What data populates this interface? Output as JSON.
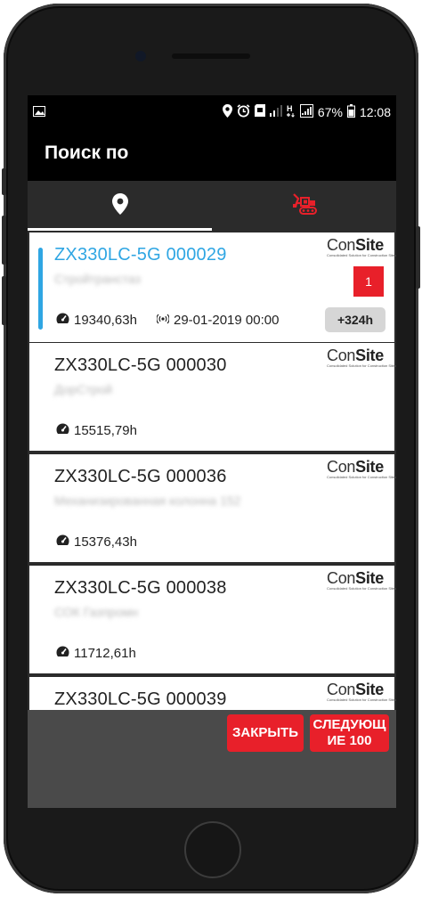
{
  "status_bar": {
    "battery_percent": "67%",
    "time": "12:08"
  },
  "app_bar": {
    "title": "Поиск по"
  },
  "tabs": [
    {
      "icon": "location-pin-icon",
      "active": true
    },
    {
      "icon": "excavator-icon",
      "active": false
    }
  ],
  "machines": [
    {
      "name": "ZX330LC-5G 000029",
      "owner": "Стройтранстаз",
      "hours": "19340,63h",
      "last_signal": "29-01-2019 00:00",
      "selected": true,
      "flag": "1",
      "hours_badge": "+324h"
    },
    {
      "name": "ZX330LC-5G 000030",
      "owner": "ДорСтрой",
      "hours": "15515,79h"
    },
    {
      "name": "ZX330LC-5G 000036",
      "owner": "Механизированная колонна 152",
      "hours": "15376,43h"
    },
    {
      "name": "ZX330LC-5G 000038",
      "owner": "СОК Газпромн",
      "hours": "11712,61h"
    },
    {
      "name": "ZX330LC-5G 000039",
      "owner": "",
      "hours": ""
    }
  ],
  "logo": {
    "con": "Con",
    "site": "Site",
    "tagline": "Consolidated Solution for Construction Sites"
  },
  "buttons": {
    "close": "ЗАКРЫТЬ",
    "next_line1": "СЛЕДУЮЩ",
    "next_line2": "ИЕ 100"
  },
  "colors": {
    "accent_blue": "#2fa6e3",
    "brand_red": "#e8202a",
    "tab_bg": "#2b2b2b"
  }
}
